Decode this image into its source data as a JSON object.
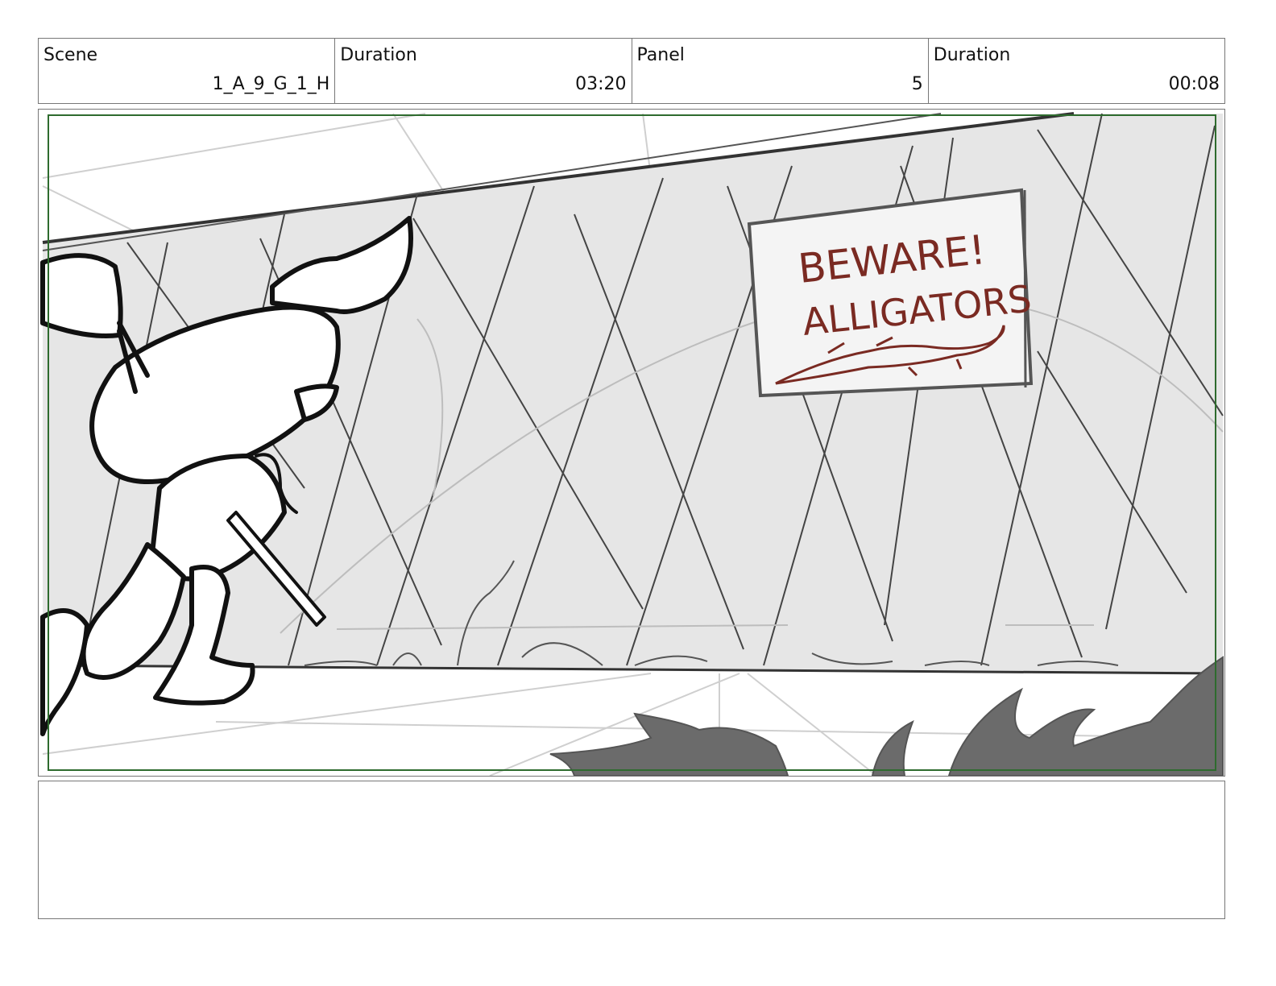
{
  "header": {
    "scene_label": "Scene",
    "scene_value": "1_A_9_G_1_H",
    "duration_label": "Duration",
    "duration_value": "03:20",
    "panel_label": "Panel",
    "panel_value": "5",
    "panel_duration_label": "Duration",
    "panel_duration_value": "00:08"
  },
  "sketch": {
    "sign_line1": "BEWARE!",
    "sign_line2": "ALLIGATORS",
    "sign_color": "#7a2a22",
    "safe_frame_color": "#2e6b2e",
    "wall_color": "#e6e6e6",
    "bush_color": "#6b6b6b"
  },
  "notes": {
    "text": ""
  }
}
